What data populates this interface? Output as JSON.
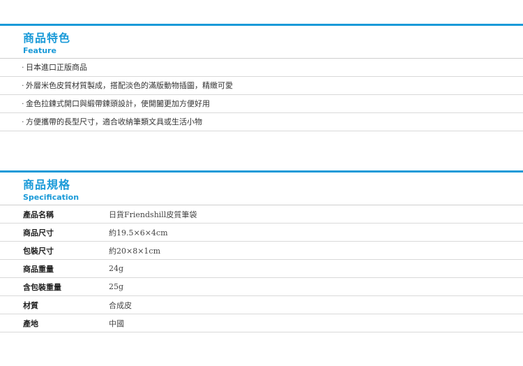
{
  "feature": {
    "title": "商品特色",
    "subtitle": "Feature",
    "items": [
      "日本進口正版商品",
      "外層米色皮質材質製成，搭配淡色的滿版動物插圖，精緻可愛",
      "金色拉鍊式開口與緞帶鍊頭設計，使開闔更加方便好用",
      "方便攜帶的長型尺寸，適合收納筆類文具或生活小物"
    ],
    "bullet": "‧"
  },
  "spec": {
    "title": "商品規格",
    "subtitle": "Specification",
    "rows": [
      {
        "label": "產品名稱",
        "value": "日貨Friendshill皮質筆袋"
      },
      {
        "label": "商品尺寸",
        "value": "約19.5×6×4cm"
      },
      {
        "label": "包裝尺寸",
        "value": "約20×8×1cm"
      },
      {
        "label": "商品重量",
        "value": "24g"
      },
      {
        "label": "含包裝重量",
        "value": "25g"
      },
      {
        "label": "材質",
        "value": "合成皮"
      },
      {
        "label": "產地",
        "value": "中國"
      }
    ]
  },
  "colors": {
    "accent": "#1a9ad8",
    "divider": "#d9d9d9"
  }
}
